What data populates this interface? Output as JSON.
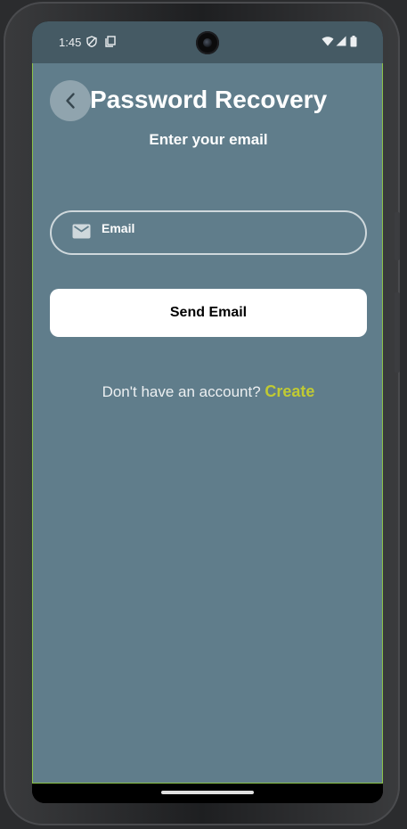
{
  "status_bar": {
    "time": "1:45"
  },
  "header": {
    "title": "Password Recovery",
    "subtitle": "Enter your email"
  },
  "form": {
    "email_placeholder": "Email",
    "email_value": "",
    "send_label": "Send Email"
  },
  "footer": {
    "prompt": "Don't have an account?",
    "create_label": "Create"
  },
  "colors": {
    "app_background": "#607d8b",
    "status_bar": "#455a64",
    "back_button": "#90a4ae",
    "link_accent": "#c0ca33",
    "button_background": "#ffffff"
  },
  "icons": {
    "back": "chevron-left-icon",
    "email": "mail-icon",
    "status": [
      "shield-icon",
      "screen-icon",
      "wifi-icon",
      "signal-icon",
      "battery-icon"
    ]
  }
}
